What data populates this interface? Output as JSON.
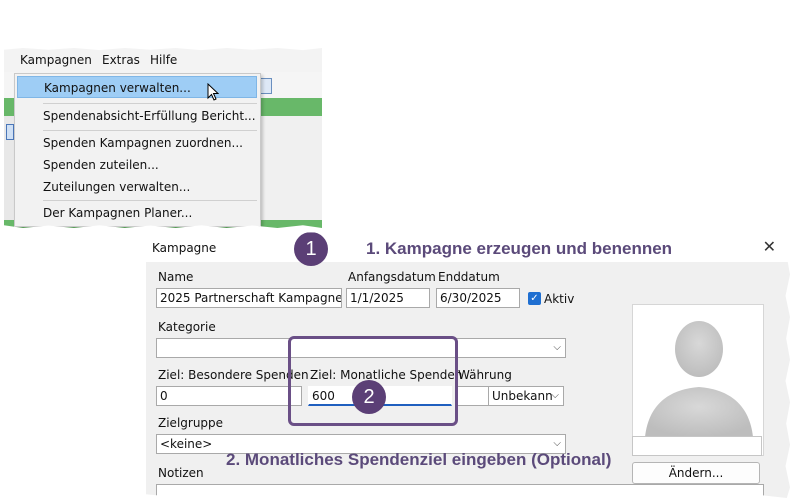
{
  "menubar": {
    "items": [
      "Kampagnen",
      "Extras",
      "Hilfe"
    ]
  },
  "menu": {
    "items": [
      "Kampagnen verwalten...",
      "Spendenabsicht-Erfüllung Bericht...",
      "Spenden Kampagnen zuordnen...",
      "Spenden zuteilen...",
      "Zuteilungen verwalten...",
      "Der Kampagnen Planer..."
    ]
  },
  "dialog": {
    "title": "Kampagne",
    "close": "✕",
    "name_label": "Name",
    "name_value": "2025 Partnerschaft Kampagne",
    "start_label": "Anfangsdatum",
    "start_value": "1/1/2025",
    "end_label": "Enddatum",
    "end_value": "6/30/2025",
    "active_label": "Aktiv",
    "category_label": "Kategorie",
    "category_value": "",
    "special_goal_label": "Ziel: Besondere Spenden",
    "special_goal_value": "0",
    "monthly_goal_label": "Ziel: Monatliche Spenden",
    "monthly_goal_value": "600",
    "currency_label": "Währung",
    "currency_value": "Unbekann",
    "target_group_label": "Zielgruppe",
    "target_group_value": "<keine>",
    "notes_label": "Notizen",
    "change_button": "Ändern..."
  },
  "annotations": {
    "step1_number": "1",
    "step1_text": "1. Kampagne erzeugen und benennen",
    "step2_number": "2",
    "step2_text": "2. Monatliches Spendenziel eingeben (Optional)",
    "accent": "#5b3f76"
  },
  "icons": {
    "cursor": "mouse-pointer-icon",
    "close": "close-icon",
    "dropdown": "chevron-down-icon",
    "avatar": "person-silhouette-icon"
  }
}
